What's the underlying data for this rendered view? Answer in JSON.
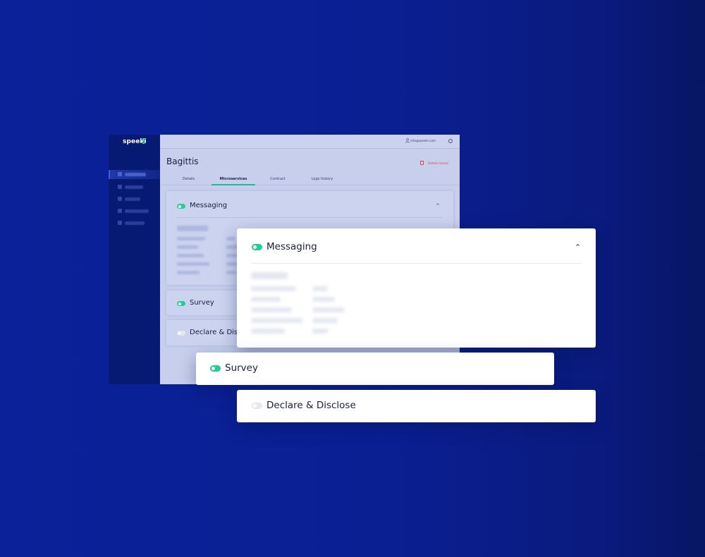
{
  "app": {
    "logo_text": "speeki",
    "user_email": "info@speeki.com",
    "page_title": "Bagittis",
    "delete_label": "Delete tenant",
    "tabs": [
      {
        "label": "Details"
      },
      {
        "label": "Microservices",
        "active": true
      },
      {
        "label": "Contract"
      },
      {
        "label": "Logs history"
      }
    ],
    "services": [
      {
        "label": "Messaging",
        "enabled": true,
        "expanded": true
      },
      {
        "label": "Survey",
        "enabled": true
      },
      {
        "label": "Declare & Disclose",
        "enabled": false
      }
    ]
  },
  "floating_cards": {
    "messaging": {
      "label": "Messaging",
      "enabled": true,
      "expanded": true
    },
    "survey": {
      "label": "Survey",
      "enabled": true
    },
    "declare": {
      "label": "Declare & Disclose",
      "enabled": false
    }
  },
  "colors": {
    "background": "#0a2199",
    "sidebar": "#061a73",
    "accent_green": "#1ed095",
    "danger_red": "#d94a4a",
    "text_dark": "#1a1f44"
  },
  "icons": {
    "user": "user-icon",
    "power": "power-icon",
    "delete": "trash-icon",
    "caret": "chevron-up-icon"
  }
}
